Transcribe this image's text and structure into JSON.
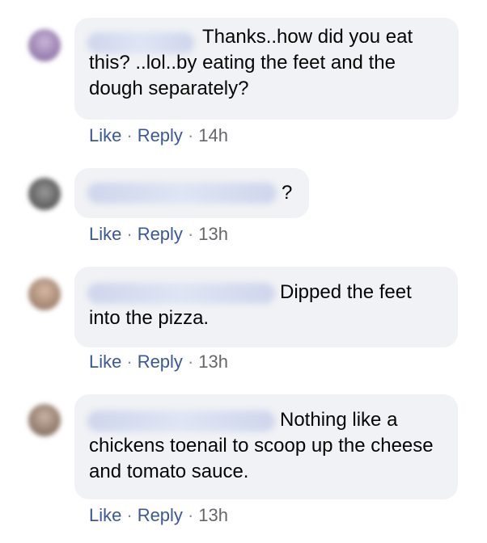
{
  "comments": [
    {
      "text": "Thanks..how did you eat this? ..lol..by eating the feet and the dough separately?",
      "actions": {
        "like": "Like",
        "reply": "Reply",
        "time": "14h"
      }
    },
    {
      "text": "?",
      "actions": {
        "like": "Like",
        "reply": "Reply",
        "time": "13h"
      }
    },
    {
      "text": "Dipped the feet into the pizza.",
      "actions": {
        "like": "Like",
        "reply": "Reply",
        "time": "13h"
      }
    },
    {
      "text": "Nothing like a chickens toenail to scoop up the cheese and tomato sauce.",
      "actions": {
        "like": "Like",
        "reply": "Reply",
        "time": "13h"
      }
    }
  ],
  "separator": "·",
  "colors": {
    "bubble": "#f0f2f5",
    "link": "#385898",
    "meta": "#65676b"
  }
}
